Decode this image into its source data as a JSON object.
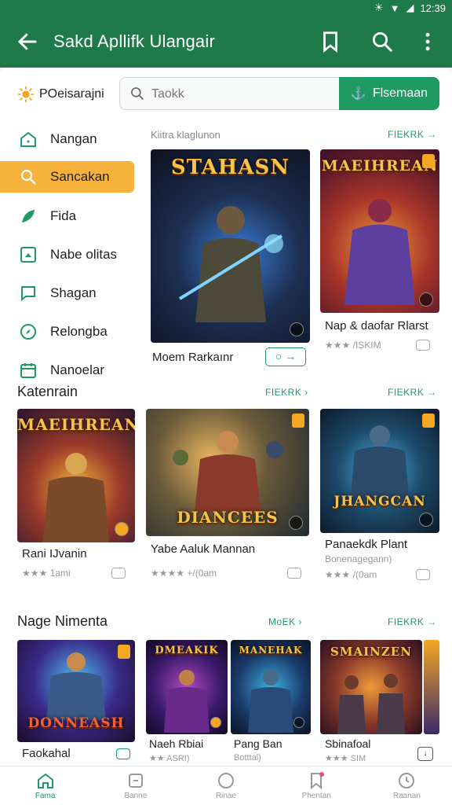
{
  "status_bar": {
    "time": "12:39"
  },
  "app_bar": {
    "title": "Sakd Apllifk Ulangair"
  },
  "brand": {
    "label": "POeisarajni"
  },
  "search": {
    "placeholder": "Taokk",
    "button_label": "Flsemaan"
  },
  "sidebar": {
    "items": [
      {
        "label": "Nangan",
        "icon": "home-icon",
        "active": false
      },
      {
        "label": "Sancakan",
        "icon": "search-icon",
        "active": true
      },
      {
        "label": "Fida",
        "icon": "leaf-icon",
        "active": false
      },
      {
        "label": "Nabe olitas",
        "icon": "gallery-icon",
        "active": false
      },
      {
        "label": "Shagan",
        "icon": "chat-icon",
        "active": false
      },
      {
        "label": "Relongba",
        "icon": "compass-icon",
        "active": false
      },
      {
        "label": "Nanoelar",
        "icon": "calendar-icon",
        "active": false
      }
    ]
  },
  "featured": {
    "section_label": "Kiitra klaglunon",
    "more_label": "FIEKRK",
    "cards": [
      {
        "cover_title": "STAHASN",
        "name": "Moem Rarkaınr"
      },
      {
        "cover_title": "MAEIHREAN",
        "name": "Nap & daofar Rlarst",
        "meta": "/ISKIM"
      }
    ]
  },
  "section2": {
    "title": "Katenrain",
    "more_label": "FIEKRK",
    "more_label_alt": "FIEKRK",
    "cards": [
      {
        "cover_title": "MAEIHREAN",
        "name": "Rani IJvanin",
        "meta": "1ami"
      },
      {
        "cover_title": "DIANCEES",
        "name": "Yabe Aaluk Mannan",
        "meta": "+/(0am"
      },
      {
        "cover_title": "JHANGCAN",
        "name": "Panaekdk Plant",
        "meta": "/(0am",
        "sub": "Bonenagegann)"
      }
    ]
  },
  "section3": {
    "title": "Nage Nimenta",
    "more_label": "MoEK",
    "more_label_alt": "FIEKRK",
    "cards": [
      {
        "cover_title": "DONNEASH",
        "name": "Faokahal"
      },
      {
        "cover_title": "DMEAKIK",
        "name": "Naeh Rbiai",
        "meta": "ASRI)"
      },
      {
        "cover_title": "MANEHAK",
        "name": "Pang Ban",
        "meta": "Botttal)"
      },
      {
        "cover_title": "SMAINZEN",
        "name": "Sbinafoal",
        "meta": "SIM"
      }
    ]
  },
  "bottom_nav": {
    "items": [
      {
        "label": "Fama",
        "icon": "home-icon",
        "active": true
      },
      {
        "label": "Banne",
        "icon": "box-icon",
        "active": false
      },
      {
        "label": "Rinae",
        "icon": "circle-icon",
        "active": false
      },
      {
        "label": "Phentan",
        "icon": "bookmark-icon",
        "active": false
      },
      {
        "label": "Raanan",
        "icon": "clock-icon",
        "active": false
      }
    ]
  },
  "colors": {
    "primary": "#1f7a4a",
    "accent": "#1f9a63",
    "active_tab": "#f7b23b",
    "badge": "#f5a623"
  }
}
